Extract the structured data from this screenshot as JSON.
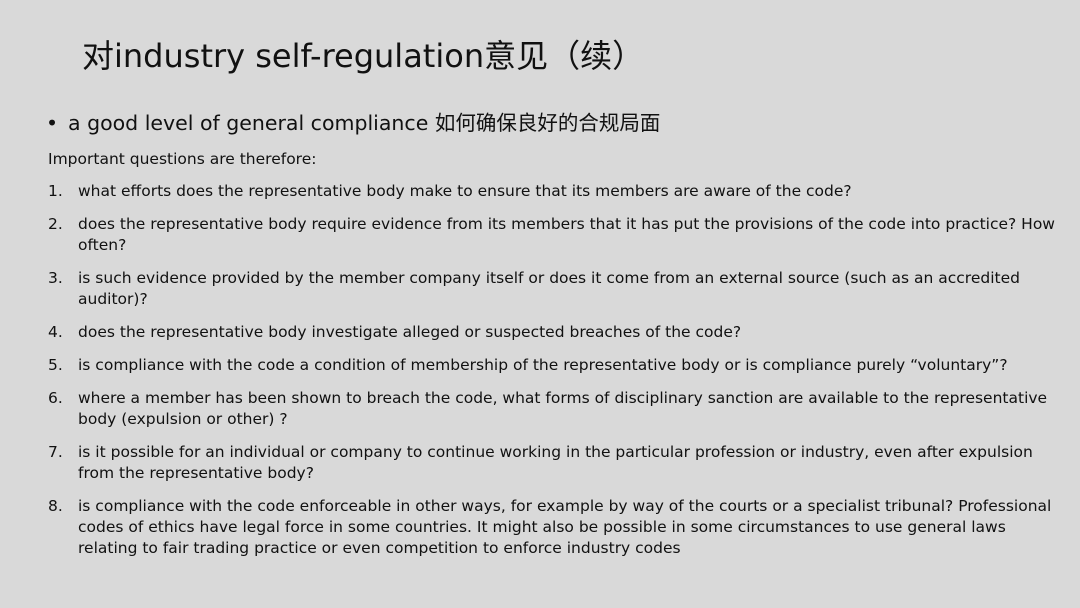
{
  "slide": {
    "title": "对industry self-regulation意见（续）",
    "bullet": {
      "symbol": "•",
      "text": "a good level of general compliance 如何确保良好的合规局面"
    },
    "intro": "Important questions are therefore:",
    "questions": [
      {
        "num": "1.",
        "text": "what efforts does the representative body make to ensure that its members are aware of the code?"
      },
      {
        "num": "2.",
        "text": "does the representative body require evidence from its members that it has put the provisions of the code into practice? How often?"
      },
      {
        "num": "3.",
        "text": "is such evidence provided by the member company itself or does it come from an external source (such as an accredited auditor)?"
      },
      {
        "num": "4.",
        "text": "does the representative body investigate alleged or suspected breaches of the code?"
      },
      {
        "num": "5.",
        "text": "is compliance with the code a condition of membership of the representative body or is compliance purely “voluntary”?"
      },
      {
        "num": "6.",
        "text": "where a member has been shown to breach the code, what forms of disciplinary sanction are available to the representative body (expulsion or other) ?"
      },
      {
        "num": "7.",
        "text": "is it possible for an individual or company to continue working in the particular profession or industry, even after expulsion from the representative body?"
      },
      {
        "num": "8.",
        "text": "is compliance with the code enforceable in other ways, for example by way of the courts or a specialist tribunal? Professional codes of ethics have legal force in some countries. It might also be possible in some circumstances to use general laws relating to fair trading practice or even competition to enforce industry codes"
      }
    ]
  }
}
